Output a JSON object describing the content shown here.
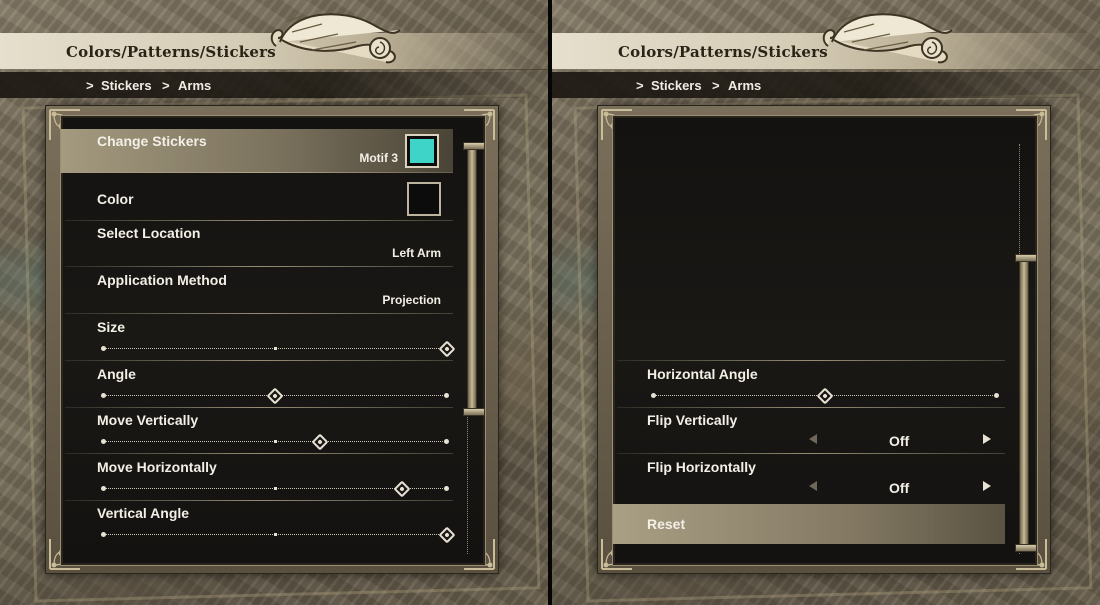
{
  "header": {
    "title": "Colors/Patterns/Stickers",
    "breadcrumb": [
      "Stickers",
      "Arms"
    ],
    "separator": ">"
  },
  "colors": {
    "sticker_swatch": "#3fd4c8",
    "color_swatch": "#0c0c0c",
    "selected_row": "#a49a7f"
  },
  "left_panel": {
    "change_stickers": {
      "label": "Change Stickers",
      "value": "Motif 3"
    },
    "color": {
      "label": "Color"
    },
    "select_location": {
      "label": "Select Location",
      "value": "Left Arm"
    },
    "application_method": {
      "label": "Application Method",
      "value": "Projection"
    },
    "sliders": [
      {
        "label": "Size",
        "value_fraction": 1.0
      },
      {
        "label": "Angle",
        "value_fraction": 0.5
      },
      {
        "label": "Move Vertically",
        "value_fraction": 0.63
      },
      {
        "label": "Move Horizontally",
        "value_fraction": 0.87
      },
      {
        "label": "Vertical Angle",
        "value_fraction": 1.0
      }
    ],
    "scroll_position": 0.0
  },
  "right_panel": {
    "horizontal_angle": {
      "label": "Horizontal Angle",
      "value_fraction": 0.5
    },
    "flip_vertically": {
      "label": "Flip Vertically",
      "value": "Off"
    },
    "flip_horizontally": {
      "label": "Flip Horizontally",
      "value": "Off"
    },
    "reset": {
      "label": "Reset"
    },
    "scroll_position": 1.0
  }
}
